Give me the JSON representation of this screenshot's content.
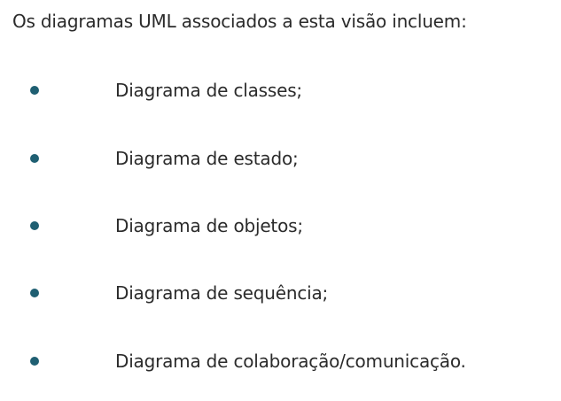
{
  "intro": "Os diagramas UML associados a esta visão incluem:",
  "bullet_color": "#1f5f72",
  "items": [
    {
      "label": "Diagrama de classes;"
    },
    {
      "label": "Diagrama de estado;"
    },
    {
      "label": "Diagrama de objetos;"
    },
    {
      "label": "Diagrama de sequência;"
    },
    {
      "label": "Diagrama de colaboração/comunicação."
    }
  ]
}
